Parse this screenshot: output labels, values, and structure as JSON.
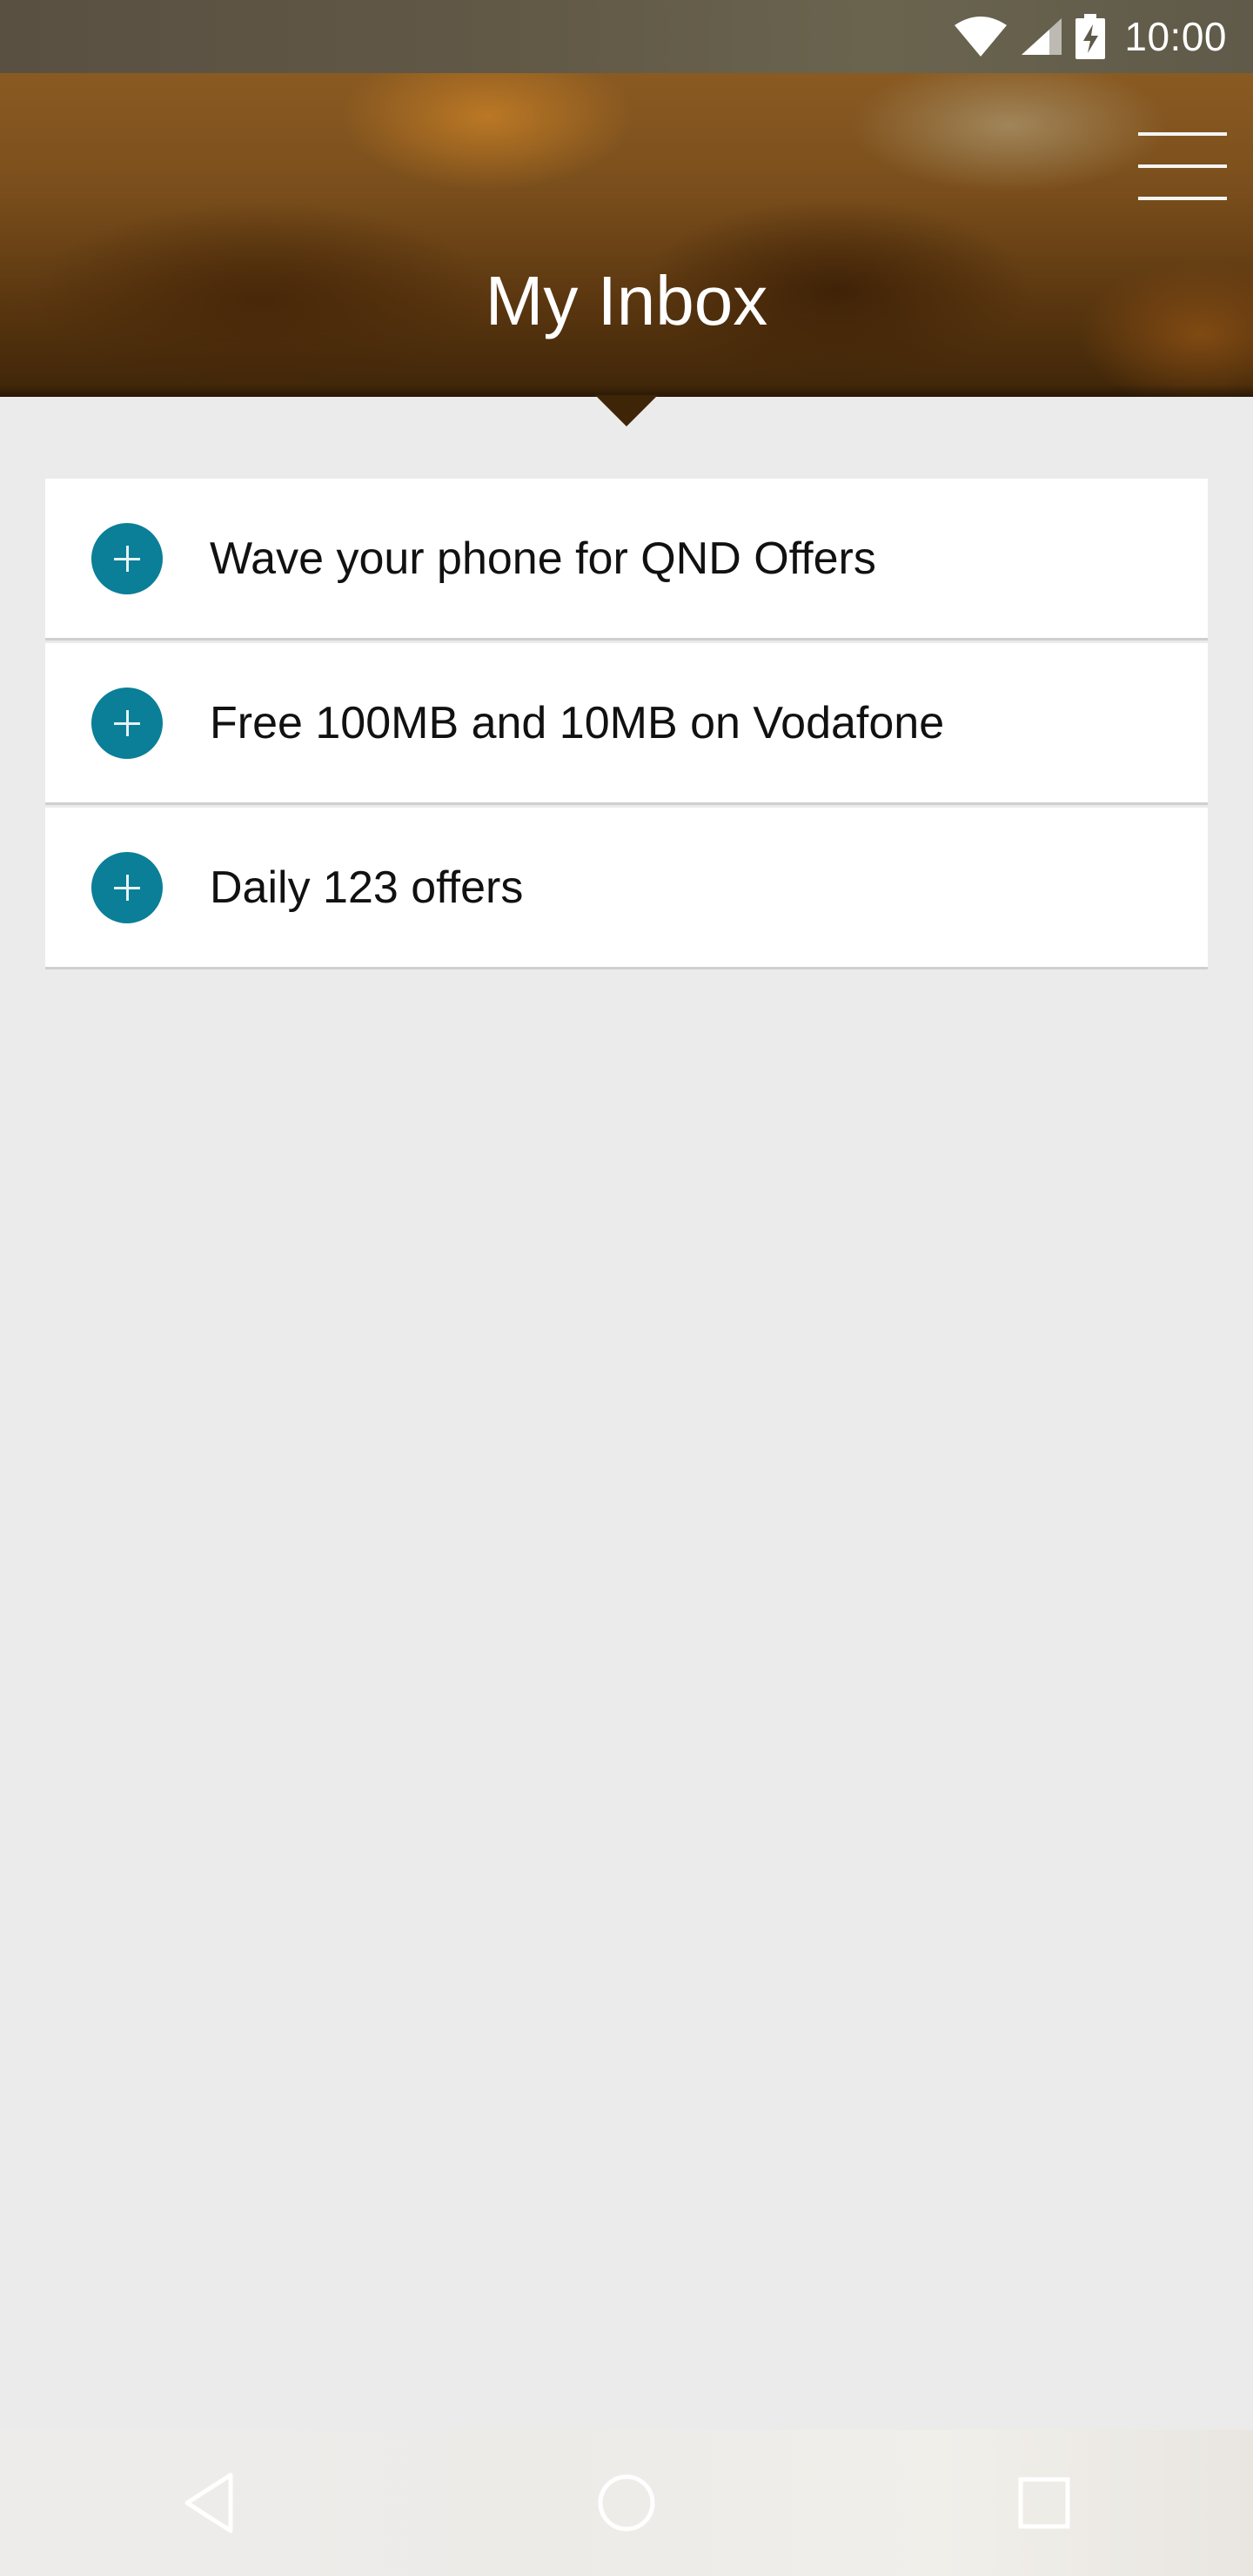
{
  "status_bar": {
    "time": "10:00",
    "icons": [
      "wifi-icon",
      "signal-icon",
      "battery-charging-icon"
    ]
  },
  "header": {
    "title": "My Inbox",
    "menu_icon": "hamburger-menu-icon"
  },
  "inbox": {
    "items": [
      {
        "label": "Wave your phone for QND Offers",
        "icon": "plus-circle-icon"
      },
      {
        "label": "Free 100MB and 10MB on Vodafone",
        "icon": "plus-circle-icon"
      },
      {
        "label": "Daily 123 offers",
        "icon": "plus-circle-icon"
      }
    ]
  },
  "nav_bar": {
    "icons": [
      "back-icon",
      "home-icon",
      "recents-icon"
    ]
  },
  "colors": {
    "accent": "#0a7f97",
    "background": "#ebebeb",
    "header_dark": "#3e2508",
    "header_light": "#8a5a22"
  }
}
